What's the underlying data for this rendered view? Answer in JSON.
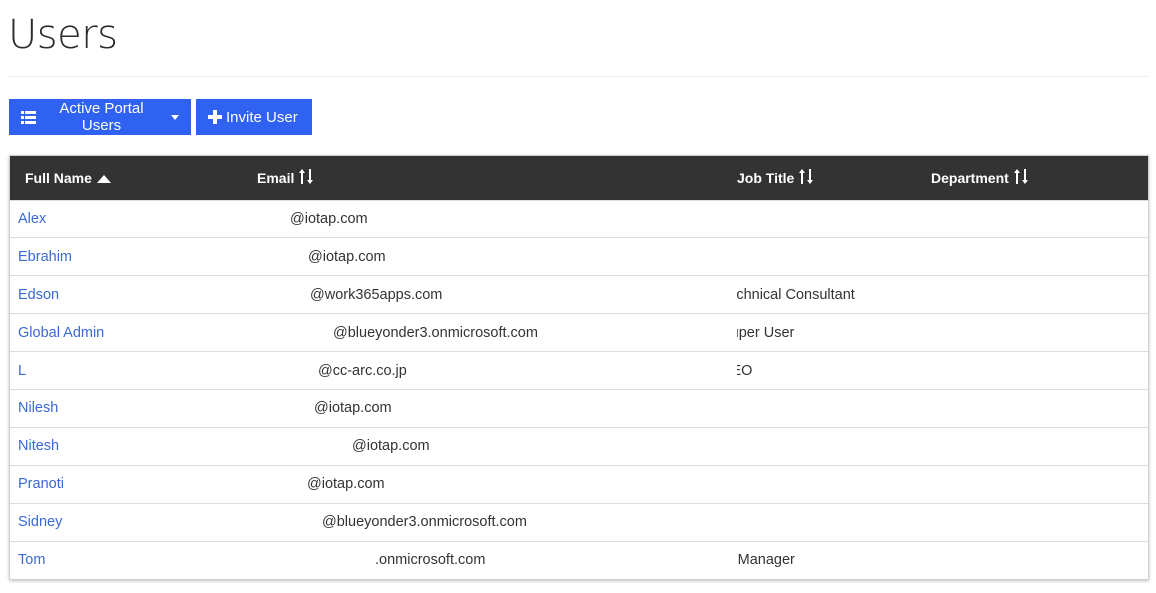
{
  "page": {
    "title": "Users"
  },
  "toolbar": {
    "views_label": "Active Portal Users",
    "invite_label": "Invite User"
  },
  "table": {
    "columns": {
      "full_name": "Full Name",
      "email": "Email",
      "job_title": "Job Title",
      "department": "Department"
    },
    "sort": {
      "column": "Full Name",
      "direction": "ascending"
    },
    "rows": [
      {
        "name": "Alex",
        "email": "@iotap.com",
        "job_title": "",
        "department": ""
      },
      {
        "name": "Ebrahim",
        "email": "@iotap.com",
        "job_title": "",
        "department": ""
      },
      {
        "name": "Edson",
        "email": "@work365apps.com",
        "job_title": "Technical Consultant",
        "department": ""
      },
      {
        "name": "Global Admin",
        "email": "@blueyonder3.onmicrosoft.com",
        "job_title": "Super User",
        "department": ""
      },
      {
        "name": "L",
        "email": "@cc-arc.co.jp",
        "job_title": "CEO",
        "department": ""
      },
      {
        "name": "Nilesh",
        "email": "@iotap.com",
        "job_title": "",
        "department": ""
      },
      {
        "name": "Nitesh",
        "email": "@iotap.com",
        "job_title": "",
        "department": ""
      },
      {
        "name": "Pranoti",
        "email": "@iotap.com",
        "job_title": "",
        "department": ""
      },
      {
        "name": "Sidney",
        "email": "@blueyonder3.onmicrosoft.com",
        "job_title": "",
        "department": ""
      },
      {
        "name": "Tom",
        "email": ".onmicrosoft.com",
        "job_title": "IT Manager",
        "department": ""
      }
    ]
  },
  "colors": {
    "button": "#2f62f1",
    "header_bg": "#333333",
    "link": "#3a6ad4"
  },
  "icons": {
    "views": "list-icon",
    "invite": "plus-icon",
    "sort_asc": "sort-asc-icon",
    "sort_both": "sort-icon"
  }
}
